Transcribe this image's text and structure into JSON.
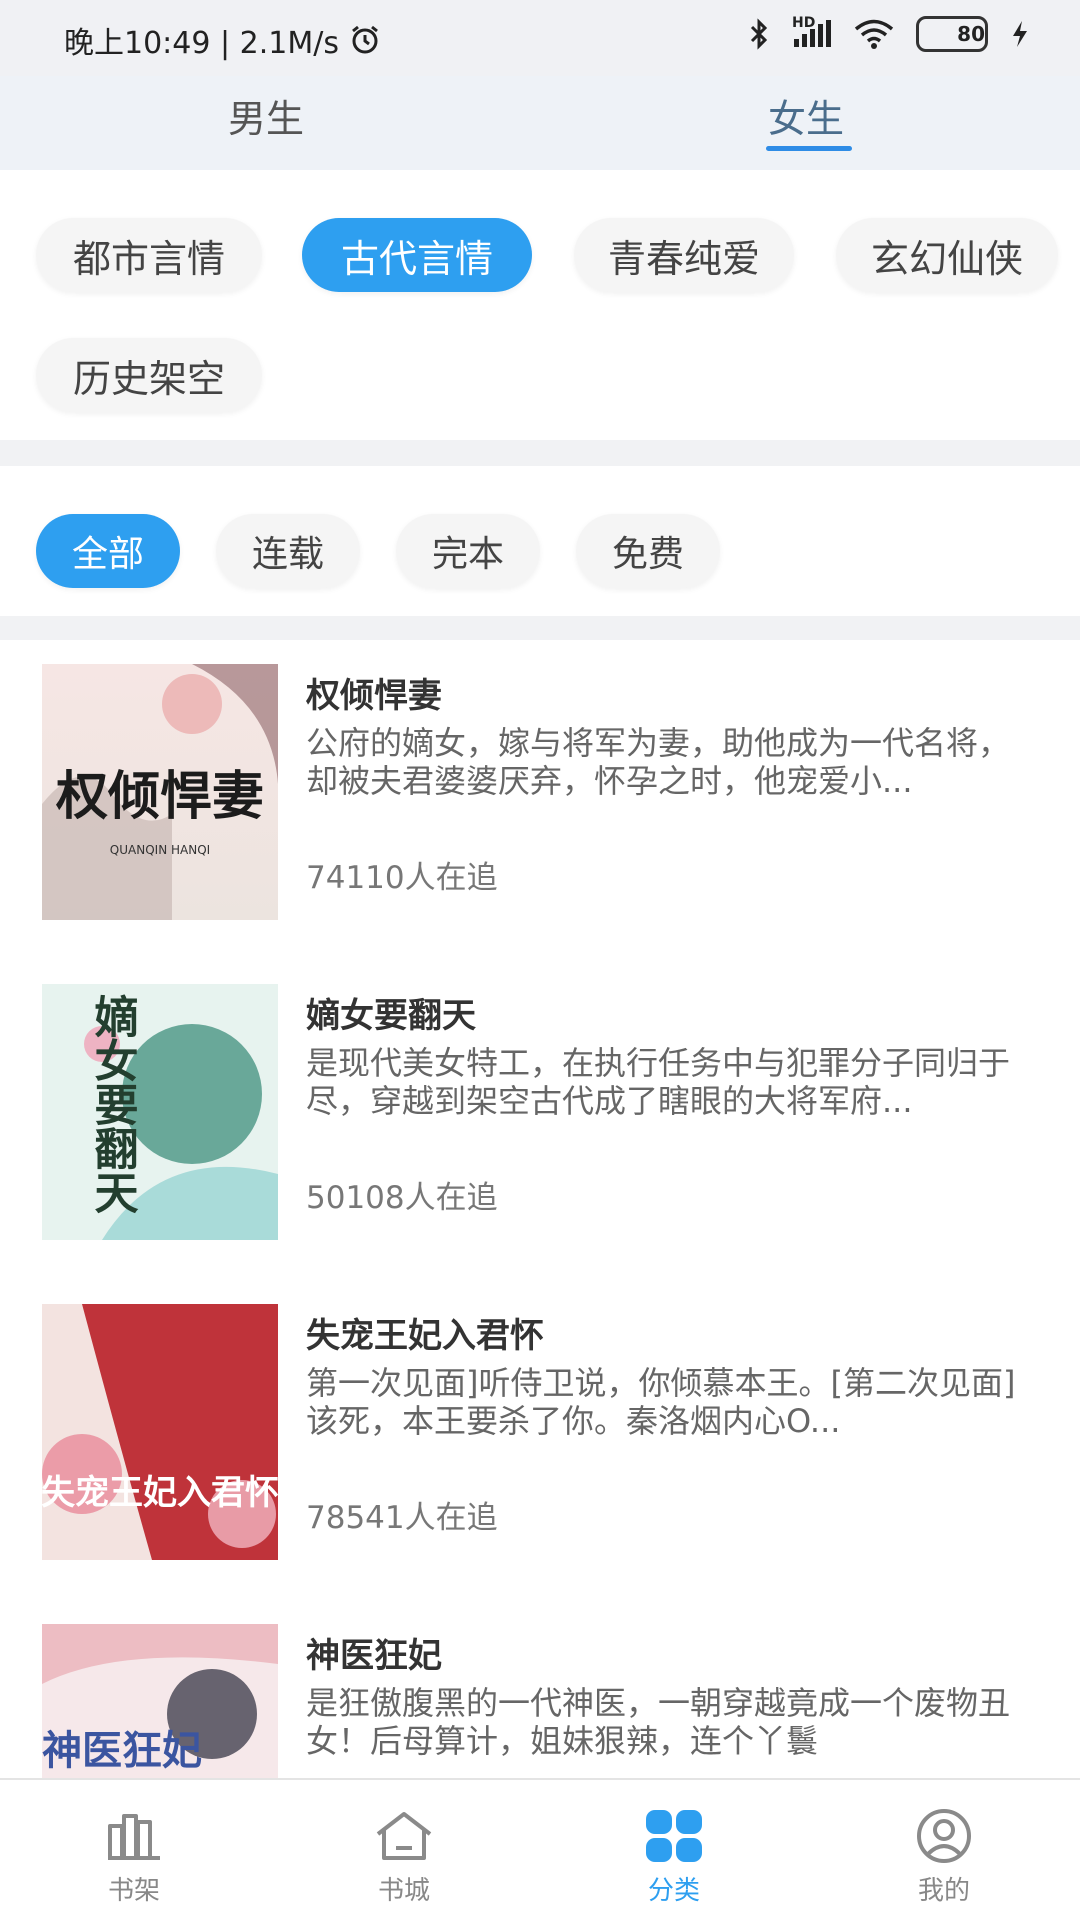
{
  "status_bar": {
    "time_speed": "晚上10:49 | 2.1M/s",
    "battery": "80",
    "network": "HD"
  },
  "gender_tabs": [
    {
      "label": "男生",
      "active": false
    },
    {
      "label": "女生",
      "active": true
    }
  ],
  "categories": [
    {
      "label": "都市言情",
      "active": false
    },
    {
      "label": "古代言情",
      "active": true
    },
    {
      "label": "青春纯爱",
      "active": false
    },
    {
      "label": "玄幻仙侠",
      "active": false
    },
    {
      "label": "历史架空",
      "active": false
    }
  ],
  "filters": [
    {
      "label": "全部",
      "active": true
    },
    {
      "label": "连载",
      "active": false
    },
    {
      "label": "完本",
      "active": false
    },
    {
      "label": "免费",
      "active": false
    }
  ],
  "books": [
    {
      "title": "权倾悍妻",
      "desc": "公府的嫡女，嫁与将军为妻，助他成为一代名将，却被夫君婆婆厌弃，怀孕之时，他宠爱小...",
      "readers": "74110人在追",
      "cover_text": "权倾悍妻",
      "cover_sub": "QUANQIN HANQI"
    },
    {
      "title": "嫡女要翻天",
      "desc": "是现代美女特工，在执行任务中与犯罪分子同归于尽，穿越到架空古代成了瞎眼的大将军府...",
      "readers": "50108人在追",
      "cover_text": "嫡女要翻天"
    },
    {
      "title": "失宠王妃入君怀",
      "desc": "第一次见面]听侍卫说，你倾慕本王。[第二次见面]该死，本王要杀了你。秦洛烟内心O...",
      "readers": "78541人在追",
      "cover_text": "失宠王妃入君怀"
    },
    {
      "title": "神医狂妃",
      "desc": "是狂傲腹黑的一代神医，一朝穿越竟成一个废物丑女！后母算计，姐妹狠辣，连个丫鬟",
      "readers": "",
      "cover_text": "神医狂妃"
    }
  ],
  "bottom_nav": [
    {
      "label": "书架",
      "icon": "bookshelf-icon",
      "active": false
    },
    {
      "label": "书城",
      "icon": "home-icon",
      "active": false
    },
    {
      "label": "分类",
      "icon": "category-icon",
      "active": true
    },
    {
      "label": "我的",
      "icon": "profile-icon",
      "active": false
    }
  ],
  "colors": {
    "accent": "#2e9ff0",
    "tab_underline": "#2e8ce6"
  }
}
